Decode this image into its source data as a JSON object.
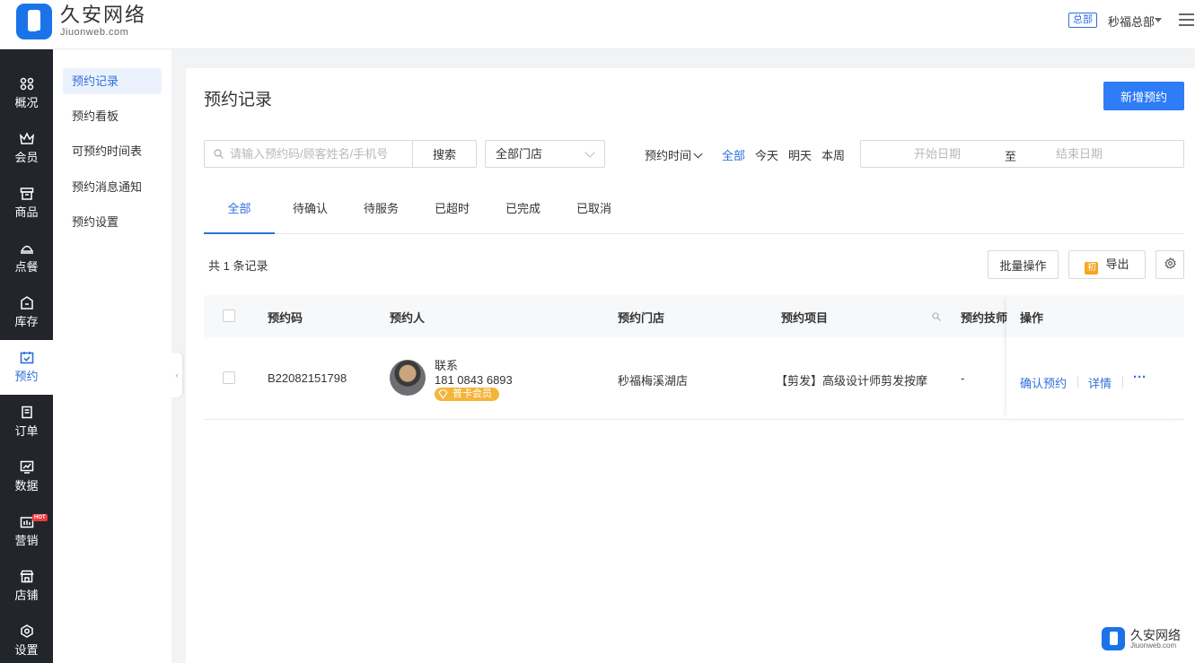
{
  "brand": {
    "name_cn": "久安网络",
    "name_en": "Jiuonweb.com"
  },
  "header": {
    "org_badge": "总部",
    "org_name": "秒福总部"
  },
  "sidebar": {
    "items": [
      {
        "label": "概况",
        "icon": "grid-icon"
      },
      {
        "label": "会员",
        "icon": "crown-icon"
      },
      {
        "label": "商品",
        "icon": "store-box-icon"
      },
      {
        "label": "点餐",
        "icon": "cloche-icon"
      },
      {
        "label": "库存",
        "icon": "inventory-icon"
      },
      {
        "label": "预约",
        "icon": "calendar-check-icon",
        "active": true
      },
      {
        "label": "订单",
        "icon": "document-icon"
      },
      {
        "label": "数据",
        "icon": "chart-icon"
      },
      {
        "label": "营销",
        "icon": "marketing-icon",
        "badge": "HOT"
      },
      {
        "label": "店铺",
        "icon": "shop-icon"
      },
      {
        "label": "设置",
        "icon": "settings-icon"
      }
    ]
  },
  "submenu": {
    "items": [
      {
        "label": "预约记录",
        "active": true
      },
      {
        "label": "预约看板"
      },
      {
        "label": "可预约时间表"
      },
      {
        "label": "预约消息通知"
      },
      {
        "label": "预约设置"
      }
    ]
  },
  "page": {
    "title": "预约记录",
    "new_button": "新增预约"
  },
  "filters": {
    "search_placeholder": "请输入预约码/顾客姓名/手机号",
    "search_button": "搜索",
    "store_select": "全部门店",
    "time_label": "预约时间",
    "quick_ranges": [
      "全部",
      "今天",
      "明天",
      "本周"
    ],
    "active_quick": "全部",
    "start_placeholder": "开始日期",
    "separator": "至",
    "end_placeholder": "结束日期"
  },
  "tabs": [
    "全部",
    "待确认",
    "待服务",
    "已超时",
    "已完成",
    "已取消"
  ],
  "list": {
    "count_text": "共 1 条记录",
    "batch_button": "批量操作",
    "export_icon_text": "初",
    "export_button": "导出"
  },
  "table": {
    "headers": {
      "code": "预约码",
      "person": "预约人",
      "store": "预约门店",
      "item": "预约项目",
      "tech": "预约技师",
      "ops": "操作"
    },
    "rows": [
      {
        "code": "B22082151798",
        "name": "联系",
        "phone": "181 0843 6893",
        "member_type": "普卡会员",
        "store": "秒福梅溪湖店",
        "item": "【剪发】高级设计师剪发按摩",
        "tech": "-",
        "confirm": "确认预约",
        "detail": "详情",
        "more": "···"
      }
    ]
  },
  "colors": {
    "primary": "#2e7cf6",
    "link": "#2e6fdc",
    "sidebar_bg": "#22252b",
    "member_badge": "#f4b53a"
  }
}
